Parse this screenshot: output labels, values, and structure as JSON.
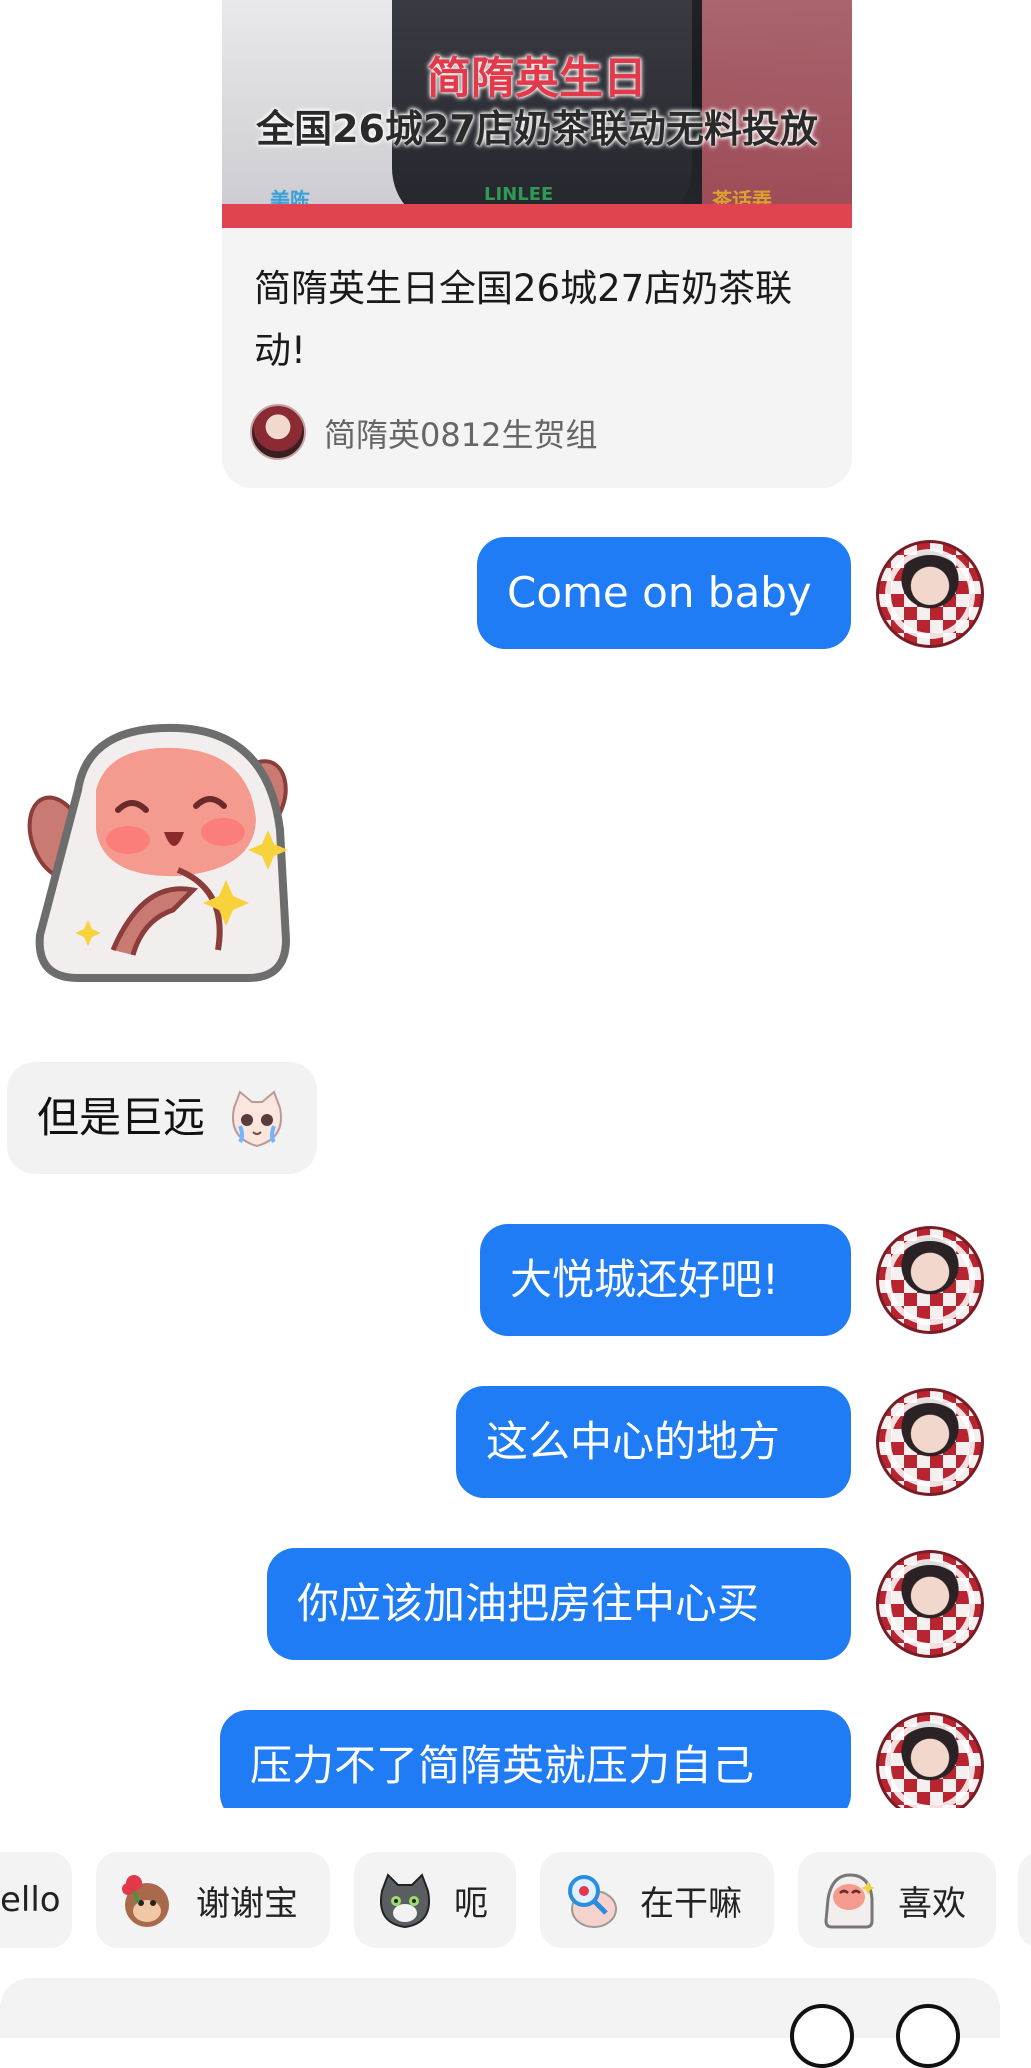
{
  "shared_card": {
    "image_title_line1": "简隋英生日",
    "image_title_line2": "全国26城27店奶茶联动无料投放",
    "sponsors": [
      "美陈",
      "LINLEE",
      "茶话弄"
    ],
    "title": "简隋英生日全国26城27店奶茶联动!",
    "author": "简隋英0812生贺组"
  },
  "messages": [
    {
      "side": "out",
      "text": "Come on baby"
    },
    {
      "side": "in",
      "type": "sticker",
      "sticker": "pink-sheep-blushing-sticker"
    },
    {
      "side": "in",
      "text": "但是巨远",
      "emoji": "crying-cat-emoji"
    },
    {
      "side": "out",
      "text": "大悦城还好吧!"
    },
    {
      "side": "out",
      "text": "这么中心的地方"
    },
    {
      "side": "out",
      "text": "你应该加油把房往中心买"
    },
    {
      "side": "out",
      "text": "压力不了简隋英就压力自己"
    }
  ],
  "quick_replies": [
    {
      "label": "ello",
      "icon": ""
    },
    {
      "label": "谢谢宝",
      "icon": "monkey-flower-icon"
    },
    {
      "label": "呃",
      "icon": "gray-cat-icon"
    },
    {
      "label": "在干嘛",
      "icon": "magnifier-pig-icon"
    },
    {
      "label": "喜欢",
      "icon": "pink-pig-icon"
    }
  ],
  "colors": {
    "outgoing_bubble": "#1f7cf4",
    "incoming_bubble": "#f2f2f2",
    "card_background": "#f4f4f4",
    "card_red_bar": "#e04450"
  }
}
